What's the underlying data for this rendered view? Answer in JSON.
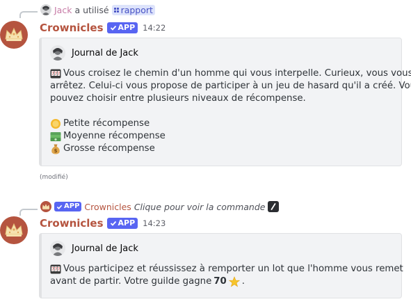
{
  "messages": [
    {
      "reply": {
        "user": "Jack",
        "action": "a utilisé",
        "command": "rapport"
      },
      "author": "Crownicles",
      "badge": "APP",
      "timestamp": "14:22",
      "embed": {
        "author": "Journal de Jack",
        "lines": [
          {
            "emoji": "slot-machine-icon",
            "text": "Vous croisez le chemin d'un homme qui vous interpelle. Curieux, vous vous"
          },
          {
            "text": "arrêtez. Celui-ci vous propose de participer à un jeu de hasard qu'il a créé. Vous"
          },
          {
            "text": "pouvez choisir entre plusieurs niveaux de récompense."
          }
        ],
        "options": [
          {
            "emoji": "coin-icon",
            "label": "Petite récompense"
          },
          {
            "emoji": "dollar-banknote-icon",
            "label": "Moyenne récompense"
          },
          {
            "emoji": "money-bag-icon",
            "label": "Grosse récompense"
          }
        ]
      },
      "edited": "(modifié)"
    },
    {
      "reply": {
        "badge": "APP",
        "name": "Crownicles",
        "text": "Clique pour voir la commande"
      },
      "author": "Crownicles",
      "badge": "APP",
      "timestamp": "14:23",
      "embed": {
        "author": "Journal de Jack",
        "line1": "Vous participez et réussissez à remporter un lot que l'homme vous remet",
        "line2_pre": "avant de partir. Votre guilde gagne",
        "line2_value": "70",
        "line2_post": "."
      }
    }
  ],
  "colors": {
    "brand": "#b5543f",
    "app_badge": "#5865f2",
    "reply_user": "#c77aa6",
    "command_chip_bg": "#dde3fb",
    "command_chip_text": "#4752c4",
    "embed_bg": "#f2f3f5"
  }
}
